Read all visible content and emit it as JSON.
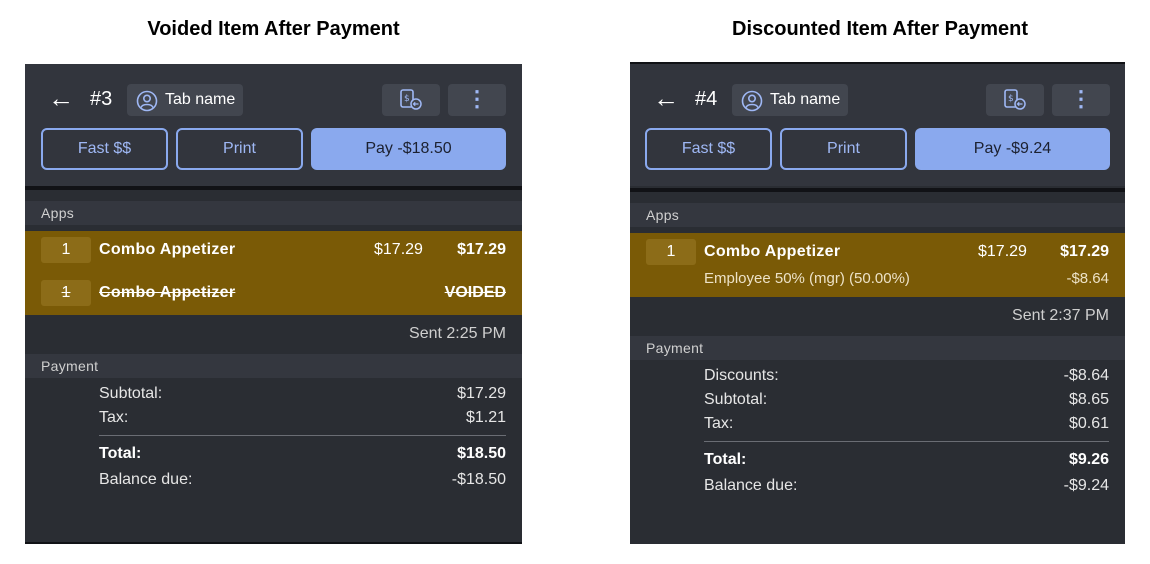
{
  "left": {
    "caption": "Voided Item After Payment",
    "check_number": "#3",
    "tab_name": "Tab name",
    "fast_label": "Fast $$",
    "print_label": "Print",
    "pay_label": "Pay -$18.50",
    "section_label": "Apps",
    "item": {
      "qty": "1",
      "name": "Combo Appetizer",
      "price": "$17.29",
      "total": "$17.29"
    },
    "voided_item": {
      "qty": "1",
      "name": "Combo Appetizer",
      "status": "VOIDED"
    },
    "sent": "Sent 2:25 PM",
    "payment_label": "Payment",
    "subtotal_label": "Subtotal:",
    "subtotal": "$17.29",
    "tax_label": "Tax:",
    "tax": "$1.21",
    "total_label": "Total:",
    "total": "$18.50",
    "balance_label": "Balance due:",
    "balance": "-$18.50"
  },
  "right": {
    "caption": "Discounted Item After Payment",
    "check_number": "#4",
    "tab_name": "Tab name",
    "fast_label": "Fast $$",
    "print_label": "Print",
    "pay_label": "Pay -$9.24",
    "section_label": "Apps",
    "item": {
      "qty": "1",
      "name": "Combo Appetizer",
      "price": "$17.29",
      "total": "$17.29"
    },
    "discount": {
      "label": "Employee 50% (mgr) (50.00%)",
      "value": "-$8.64"
    },
    "sent": "Sent 2:37 PM",
    "payment_label": "Payment",
    "discounts_label": "Discounts:",
    "discounts": "-$8.64",
    "subtotal_label": "Subtotal:",
    "subtotal": "$8.65",
    "tax_label": "Tax:",
    "tax": "$0.61",
    "total_label": "Total:",
    "total": "$9.26",
    "balance_label": "Balance due:",
    "balance": "-$9.24"
  },
  "colors": {
    "panel": "#2a2d33",
    "header": "#32353d",
    "highlight": "#7a5a06",
    "accent": "#8aa9ee"
  }
}
